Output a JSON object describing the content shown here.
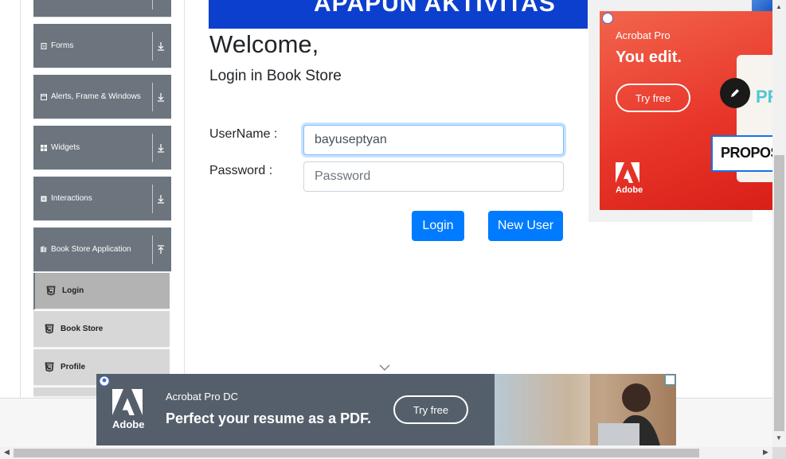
{
  "banner": {
    "text": "APAPUN AKTIVITAS"
  },
  "sidebar": {
    "groups": [
      {
        "label": "",
        "icon": "elements-icon",
        "expanded": false
      },
      {
        "label": "Forms",
        "icon": "forms-icon",
        "expanded": false
      },
      {
        "label": "Alerts, Frame & Windows",
        "icon": "window-icon",
        "expanded": false
      },
      {
        "label": "Widgets",
        "icon": "widgets-icon",
        "expanded": false
      },
      {
        "label": "Interactions",
        "icon": "interactions-icon",
        "expanded": false
      },
      {
        "label": "Book Store Application",
        "icon": "book-icon",
        "expanded": true
      }
    ],
    "items": [
      {
        "label": "Login",
        "icon": "html5-icon",
        "active": true
      },
      {
        "label": "Book Store",
        "icon": "html5-icon",
        "active": false
      },
      {
        "label": "Profile",
        "icon": "html5-icon",
        "active": false
      }
    ]
  },
  "main": {
    "welcome": "Welcome,",
    "subtitle": "Login in Book Store",
    "username_label": "UserName :",
    "username_value": "bayuseptyan",
    "password_label": "Password :",
    "password_placeholder": "Password",
    "login_button": "Login",
    "new_user_button": "New User"
  },
  "ad_right": {
    "brand": "Acrobat Pro",
    "headline": "You edit.",
    "cta": "Try free",
    "laptop_text": "PR",
    "proposal_text": "PROPOSA",
    "logo_text": "Adobe"
  },
  "ad_bottom": {
    "brand": "Acrobat Pro DC",
    "headline": "Perfect your resume as a PDF.",
    "cta": "Try free",
    "logo_text": "Adobe"
  },
  "colors": {
    "primary": "#007bff",
    "sidebar_group": "#6c757d",
    "banner": "#0d3fcf",
    "adobe_red": "#e8362a"
  }
}
